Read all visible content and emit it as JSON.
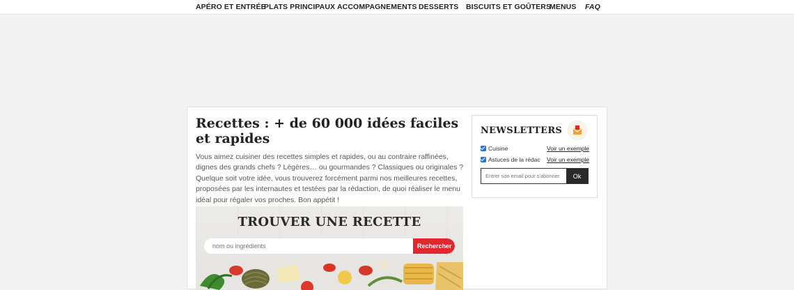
{
  "nav": {
    "items": [
      {
        "label": "APÉRO ET ENTRÉE"
      },
      {
        "label": "PLATS PRINCIPAUX"
      },
      {
        "label": "ACCOMPAGNEMENTS"
      },
      {
        "label": "DESSERTS"
      },
      {
        "label": "BISCUITS ET GOÛTERS"
      },
      {
        "label": "MENUS"
      },
      {
        "label": "FAQ"
      }
    ]
  },
  "main": {
    "title": "Recettes : + de 60 000 idées faciles et rapides",
    "intro": "Vous aimez cuisiner des recettes simples et rapides, ou au contraire raffinées, dignes des grands chefs ? Légères… ou gourmandes ? Classiques ou originales ? Quelque soit votre idée, vous trouverez forcément parmi nos meilleures recettes, proposées par les internautes et testées par la rédaction, de quoi réaliser le menu idéal pour régaler vos proches. Bon appétit !",
    "finder": {
      "title": "TROUVER UNE RECETTE",
      "placeholder": "nom ou ingrédients",
      "button": "Rechercher"
    }
  },
  "newsletter": {
    "title": "NEWSLETTERS",
    "options": [
      {
        "label": "Cuisine",
        "link": "Voir un exemple",
        "checked": true
      },
      {
        "label": "Astuces de la rédac",
        "link": "Voir un exemple",
        "checked": true
      }
    ],
    "email_placeholder": "Entrer son email pour s'abonner",
    "ok_label": "Ok"
  },
  "colors": {
    "accent": "#e0262e",
    "checkbox": "#2b73d6",
    "dark_button": "#2a2a2a"
  }
}
